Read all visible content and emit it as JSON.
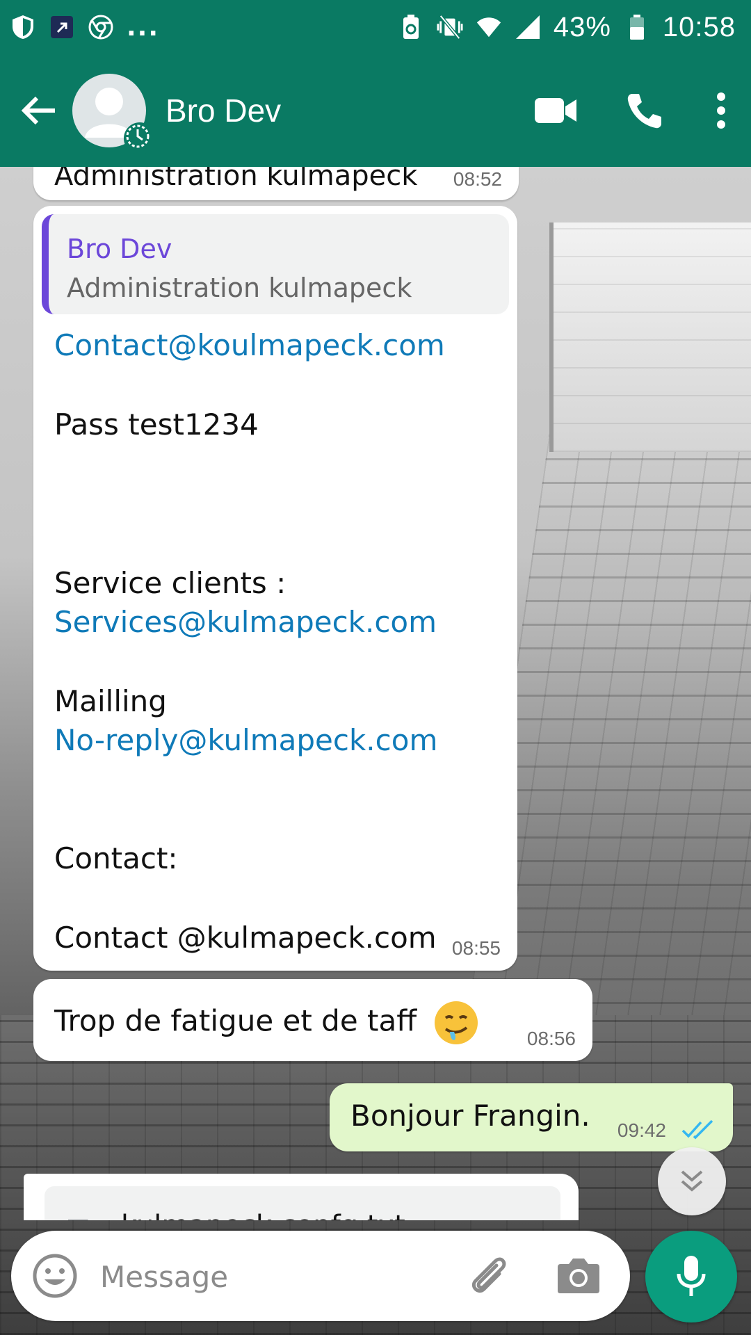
{
  "status_bar": {
    "overflow_dots": "...",
    "battery_percent": "43%",
    "time": "10:58",
    "icons_left": [
      "shield-icon",
      "app-notification-icon",
      "chrome-icon"
    ],
    "icons_right": [
      "battery-saver-icon",
      "vibrate-mute-icon",
      "wifi-icon",
      "signal-icon",
      "battery-icon"
    ]
  },
  "header": {
    "contact_name": "Bro Dev",
    "actions": [
      "video-call-icon",
      "voice-call-icon",
      "more-options-icon"
    ]
  },
  "colors": {
    "header": "#0a7a63",
    "outgoing_bubble": "#e2f7cb",
    "incoming_bubble": "#ffffff",
    "quote_accent": "#6c47d9",
    "link": "#0f7ab8",
    "read_ticks": "#34b7f1",
    "mic_button": "#0a9d7e"
  },
  "messages": {
    "prev": {
      "text": "Administration kulmapeck",
      "time": "08:52"
    },
    "main": {
      "quote_author": "Bro Dev",
      "quote_text": "Administration kulmapeck",
      "email1": "Contact@koulmapeck.com",
      "pass": "Pass test1234",
      "service_label": "Service clients :",
      "service_email": "Services@kulmapeck.com",
      "mailing_label": "Mailling",
      "mailing_email": "No-reply@kulmapeck.com",
      "contact_label": "Contact:",
      "contact_email": "Contact @kulmapeck.com",
      "time": "08:55"
    },
    "tired": {
      "text": "Trop de fatigue et de taff",
      "time": "08:56"
    },
    "hello": {
      "text": "Bonjour Frangin.",
      "time": "09:42",
      "status": "read"
    },
    "file": {
      "name": "kulmapeck.confg.txt"
    }
  },
  "composer": {
    "placeholder": "Message"
  }
}
